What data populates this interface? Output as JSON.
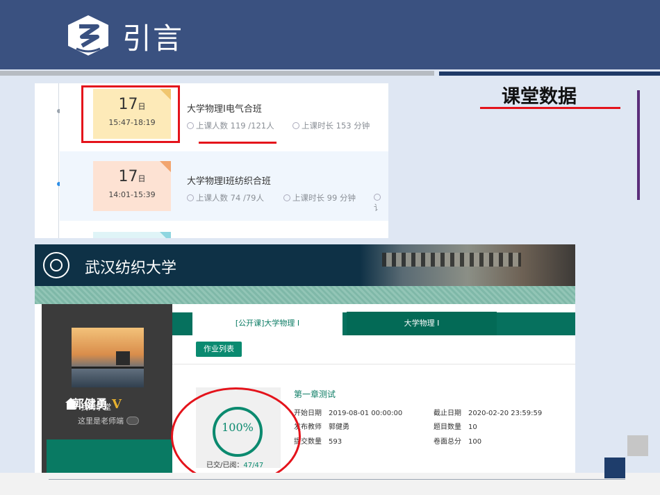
{
  "slide": {
    "title": "引言",
    "side_label": "课堂数据"
  },
  "class_list": [
    {
      "day": "17",
      "day_unit": "日",
      "time": "15:47-18:19",
      "name": "大学物理I电气合班",
      "attendance": "上课人数 119 /121人",
      "duration": "上课时长 153 分钟"
    },
    {
      "day": "17",
      "day_unit": "日",
      "time": "14:01-15:39",
      "name": "大学物理I班纺织合班",
      "attendance": "上课人数 74 /79人",
      "duration": "上课时长 99 分钟",
      "extra": "讠"
    }
  ],
  "portal": {
    "university": "武汉纺织大学",
    "user": {
      "name": "郭健勇",
      "badge": "V",
      "note": "这里是老师端"
    },
    "menu": {
      "home_label": "我的学堂"
    },
    "tabs": [
      {
        "label": "[公开课]大学物理 I"
      },
      {
        "label": "大学物理 I"
      }
    ],
    "list_button": "作业列表",
    "progress": {
      "percent_label": "100%",
      "percent_value": 100,
      "read_label": "已交/已阅：",
      "read_value": "47/47"
    },
    "assignment": {
      "title": "第一章测试",
      "start_label": "开始日期",
      "start_value": "2019-08-01 00:00:00",
      "end_label": "截止日期",
      "end_value": "2020-02-20 23:59:59",
      "teacher_label": "发布教师",
      "teacher_value": "郭健勇",
      "questions_label": "题目数量",
      "questions_value": "10",
      "submitted_label": "提交数量",
      "submitted_value": "593",
      "score_label": "卷面总分",
      "score_value": "100"
    }
  },
  "colors": {
    "header": "#3a5180",
    "accent_red": "#e4131b",
    "teal": "#0a8a70"
  }
}
